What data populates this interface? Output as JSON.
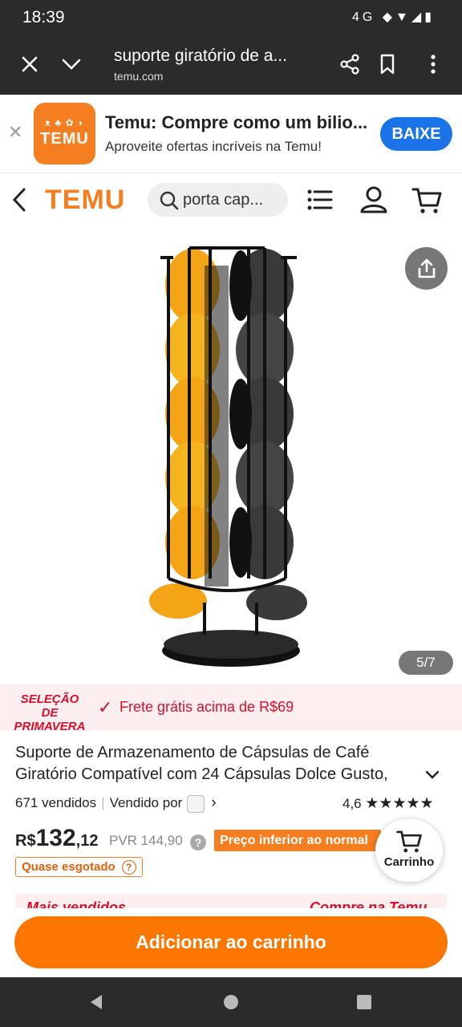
{
  "status_bar": {
    "time": "18:39",
    "icons": "4G ◆▼◢▮"
  },
  "browser": {
    "title": "suporte giratório de a...",
    "url": "temu.com"
  },
  "promo": {
    "app_logo_text": "TEMU",
    "title": "Temu: Compre como um bilio...",
    "subtitle": "Aproveite ofertas incríveis na Temu!",
    "install_label": "BAIXE"
  },
  "header": {
    "brand": "TEMU",
    "search_value": "porta cap..."
  },
  "gallery": {
    "counter": "5/7"
  },
  "promo_banner": {
    "badge_line1": "SELEÇÃO",
    "badge_line2": "DE PRIMAVERA",
    "free_shipping": "Frete grátis acima de R$69"
  },
  "product": {
    "title": "Suporte de Armazenamento de Cápsulas de Café Giratório Compatível com 24 Cápsulas Dolce Gusto,",
    "sold": "671 vendidos",
    "sold_by": "Vendido por",
    "rating": "4,6",
    "rating_value": 4.6,
    "stars": "★★★★★",
    "price_currency": "R$",
    "price_int": "132",
    "price_dec": ",12",
    "rrp": "PVR 144,90",
    "lower_price_label": "Preço inferior ao normal",
    "low_stock": "Quase esgotado"
  },
  "cart_fab": {
    "label": "Carrinho"
  },
  "bestseller": {
    "left": "Mais vendidos",
    "right": "Compre na Temu"
  },
  "add_to_cart": "Adicionar ao carrinho",
  "colors": {
    "brand_orange": "#f57e20",
    "cta_orange": "#fb7701",
    "promo_red": "#d8102c",
    "install_blue": "#1a73e8"
  }
}
